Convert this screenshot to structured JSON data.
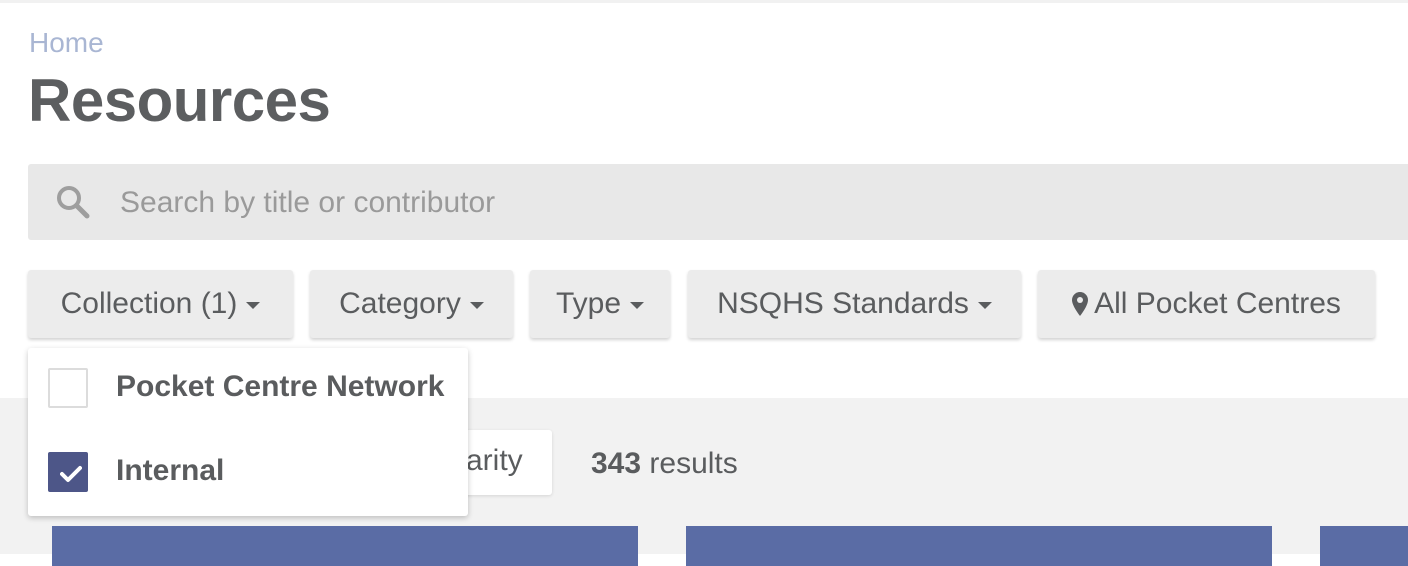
{
  "breadcrumb": {
    "home": "Home"
  },
  "page": {
    "title": "Resources"
  },
  "search": {
    "placeholder": "Search by title or contributor",
    "value": ""
  },
  "filters": {
    "collection": "Collection (1)",
    "category": "Category",
    "type": "Type",
    "nsqhs": "NSQHS Standards",
    "centres": "All Pocket Centres"
  },
  "collection_dropdown": {
    "options": [
      {
        "label": "Pocket Centre Network",
        "checked": false
      },
      {
        "label": "Internal",
        "checked": true
      }
    ]
  },
  "sort": {
    "label_visible": "arity"
  },
  "results": {
    "count": "343",
    "suffix": " results"
  },
  "colors": {
    "accent": "#4d5688",
    "card": "#5a6ca5",
    "breadcrumb": "#a9b6d3",
    "search_bg": "#e8e8e8",
    "filter_bg": "#ececec"
  },
  "icons": {
    "search": "search-icon",
    "caret": "caret-down-icon",
    "pin": "map-pin-icon",
    "check": "checkmark-icon"
  }
}
